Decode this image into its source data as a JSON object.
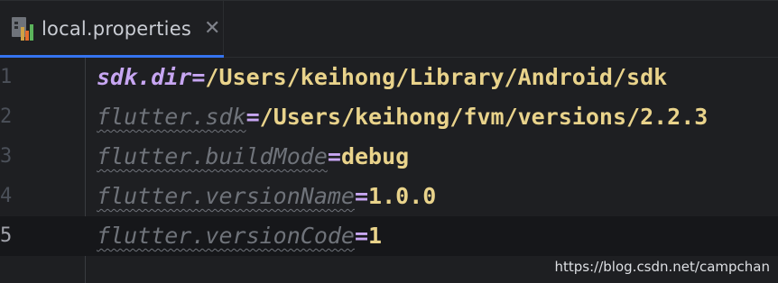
{
  "tab": {
    "title": "local.properties",
    "close_glyph": "✕",
    "icon": "properties-file-icon"
  },
  "colors": {
    "background": "#1e1f22",
    "key_main": "#c7a6f2",
    "key_unused": "#6f737a",
    "value": "#e9d38b",
    "tab_accent": "#3574f0"
  },
  "editor": {
    "current_line": 5,
    "lines": [
      {
        "num": "1",
        "key": "sdk.dir",
        "eq": "=",
        "value": "/Users/keihong/Library/Android/sdk"
      },
      {
        "num": "2",
        "key": "flutter.sdk",
        "eq": "=",
        "value": "/Users/keihong/fvm/versions/2.2.3"
      },
      {
        "num": "3",
        "key": "flutter.buildMode",
        "eq": "=",
        "value": "debug"
      },
      {
        "num": "4",
        "key": "flutter.versionName",
        "eq": "=",
        "value": "1.0.0"
      },
      {
        "num": "5",
        "key": "flutter.versionCode",
        "eq": "=",
        "value": "1"
      }
    ]
  },
  "watermark": "https://blog.csdn.net/campchan"
}
